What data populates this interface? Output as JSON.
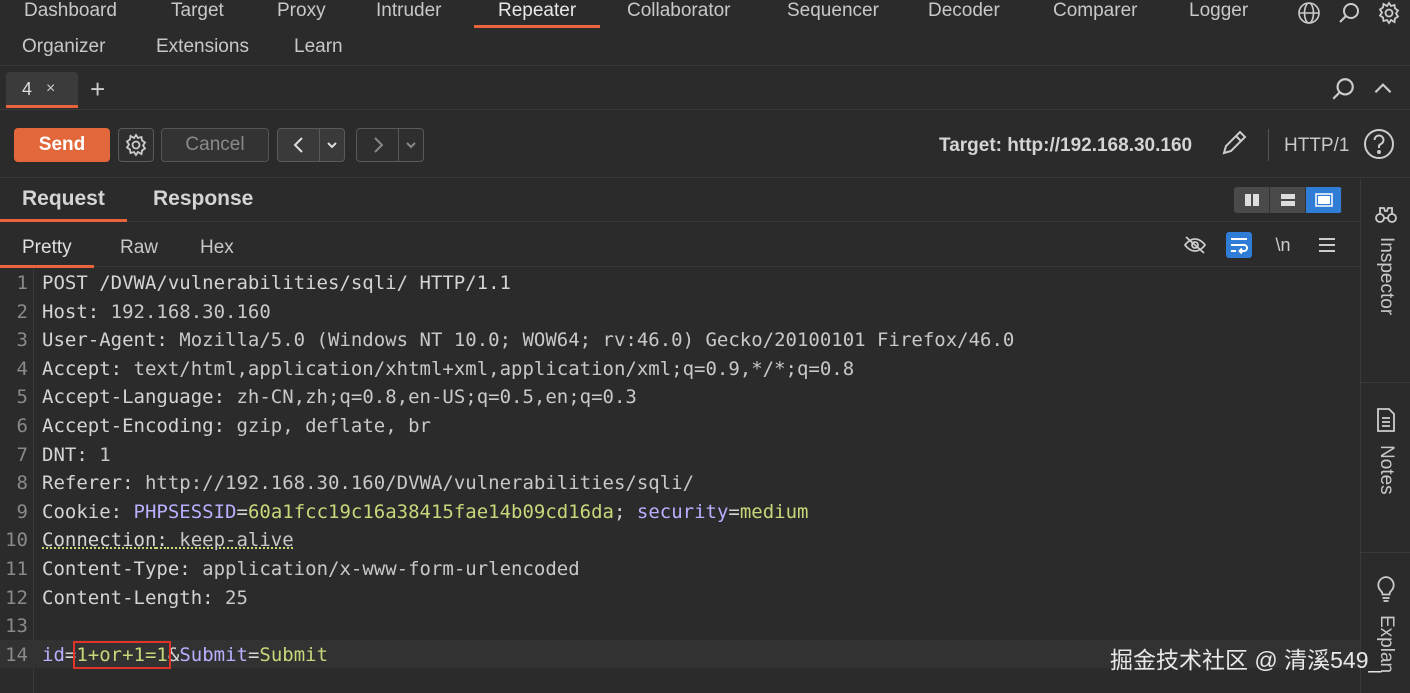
{
  "nav": {
    "row1": [
      "Dashboard",
      "Target",
      "Proxy",
      "Intruder",
      "Repeater",
      "Collaborator",
      "Sequencer",
      "Decoder",
      "Comparer",
      "Logger"
    ],
    "row2": [
      "Organizer",
      "Extensions",
      "Learn"
    ],
    "active": "Repeater",
    "icons": [
      "globe-icon",
      "search-icon",
      "gear-icon"
    ]
  },
  "tabs": {
    "current": "4",
    "close": "×",
    "add": "+"
  },
  "toolbar": {
    "send": "Send",
    "cancel": "Cancel",
    "target": "Target: http://192.168.30.160",
    "protocol": "HTTP/1"
  },
  "panel": {
    "request": "Request",
    "response": "Response"
  },
  "subtabs": {
    "pretty": "Pretty",
    "raw": "Raw",
    "hex": "Hex",
    "newline": "\\n"
  },
  "request_lines": [
    {
      "n": "1",
      "k": "POST /DVWA/vulnerabilities/sqli/ HTTP/1.1",
      "v": ""
    },
    {
      "n": "2",
      "k": "Host",
      "v": " 192.168.30.160"
    },
    {
      "n": "3",
      "k": "User-Agent",
      "v": " Mozilla/5.0 (Windows NT 10.0; WOW64; rv:46.0) Gecko/20100101 Firefox/46.0"
    },
    {
      "n": "4",
      "k": "Accept",
      "v": " text/html,application/xhtml+xml,application/xml;q=0.9,*/*;q=0.8"
    },
    {
      "n": "5",
      "k": "Accept-Language",
      "v": " zh-CN,zh;q=0.8,en-US;q=0.5,en;q=0.3"
    },
    {
      "n": "6",
      "k": "Accept-Encoding",
      "v": " gzip, deflate, br"
    },
    {
      "n": "7",
      "k": "DNT",
      "v": " 1"
    },
    {
      "n": "8",
      "k": "Referer",
      "v": " http://192.168.30.160/DVWA/vulnerabilities/sqli/"
    },
    {
      "n": "9",
      "k": "Cookie",
      "v": ""
    },
    {
      "n": "10",
      "k": "Connection",
      "v": " keep-alive"
    },
    {
      "n": "11",
      "k": "Content-Type",
      "v": " application/x-www-form-urlencoded"
    },
    {
      "n": "12",
      "k": "Content-Length",
      "v": " 25"
    },
    {
      "n": "13",
      "k": "",
      "v": ""
    },
    {
      "n": "14",
      "k": "",
      "v": ""
    }
  ],
  "cookie": {
    "name1": "PHPSESSID",
    "val1": "60a1fcc19c16a38415fae14b09cd16da",
    "sep": "; ",
    "name2": "security",
    "val2": "medium"
  },
  "body": {
    "p1": "id",
    "v1": "1+or+1=1",
    "amp": "&",
    "p2": "Submit",
    "v2": "Submit"
  },
  "sidebar": {
    "inspector": "Inspector",
    "notes": "Notes",
    "explain": "Explan"
  },
  "watermark": "掘金技术社区 @ 清溪549_",
  "colors": {
    "accent": "#e8643c",
    "send": "#e2673a",
    "select": "#2f7dd6",
    "param_name": "#b6b0ff",
    "param_value": "#c9d67a",
    "highlight_box": "#e0342b"
  }
}
